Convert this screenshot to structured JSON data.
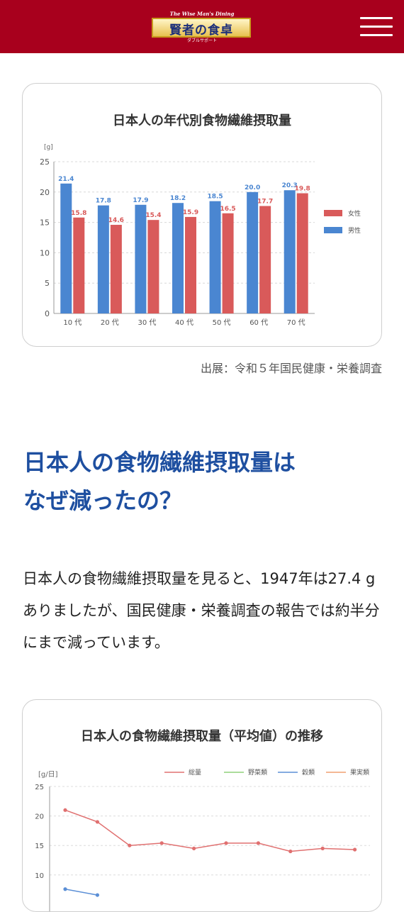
{
  "header": {
    "logo_top": "The Wise Man's Dining",
    "logo_title": "賢者の食卓",
    "logo_sub": "ダブルサポート",
    "menu_icon": "hamburger-menu-icon"
  },
  "chart1": {
    "title": "日本人の年代別食物繊維摂取量",
    "source": "出展：令和５年国民健康・栄養調査"
  },
  "article": {
    "heading_line1": "日本人の食物繊維摂取量は",
    "heading_line2": "なぜ減ったの？",
    "body": "日本人の食物繊維摂取量を見ると、1947年は27.4 gありましたが、国民健康・栄養調査の報告では約半分にまで減っています。"
  },
  "chart2": {
    "title": "日本人の食物繊維摂取量（平均値）の推移"
  },
  "chart_data": [
    {
      "type": "bar",
      "title": "日本人の年代別食物繊維摂取量",
      "ylabel": "[g]",
      "categories": [
        "10 代",
        "20 代",
        "30 代",
        "40 代",
        "50 代",
        "60 代",
        "70 代"
      ],
      "series": [
        {
          "name": "男性",
          "color": "#4a86d1",
          "values": [
            21.4,
            17.8,
            17.9,
            18.2,
            18.5,
            20.0,
            20.3
          ]
        },
        {
          "name": "女性",
          "color": "#d95a5a",
          "values": [
            15.8,
            14.6,
            15.4,
            15.9,
            16.5,
            17.7,
            19.8
          ]
        }
      ],
      "ylim": [
        0,
        25
      ],
      "yticks": [
        0,
        5,
        10,
        15,
        20,
        25
      ],
      "legend": "right",
      "grid": true
    },
    {
      "type": "line",
      "title": "日本人の食物繊維摂取量（平均値）の推移",
      "ylabel": "[g/日]",
      "ylim": [
        0,
        25
      ],
      "yticks": [
        10,
        15,
        20,
        25
      ],
      "legend": "top",
      "grid": true,
      "series": [
        {
          "name": "総量",
          "color": "#e07070",
          "values": [
            21.0,
            19.0,
            15.0,
            15.4,
            14.5,
            15.4,
            15.4,
            14.0,
            14.5,
            14.3
          ]
        },
        {
          "name": "野菜類",
          "color": "#8fd17a",
          "values": []
        },
        {
          "name": "穀類",
          "color": "#5b8fd6",
          "values": [
            7.6,
            6.6
          ]
        },
        {
          "name": "果実類",
          "color": "#f0a070",
          "values": []
        }
      ]
    }
  ]
}
